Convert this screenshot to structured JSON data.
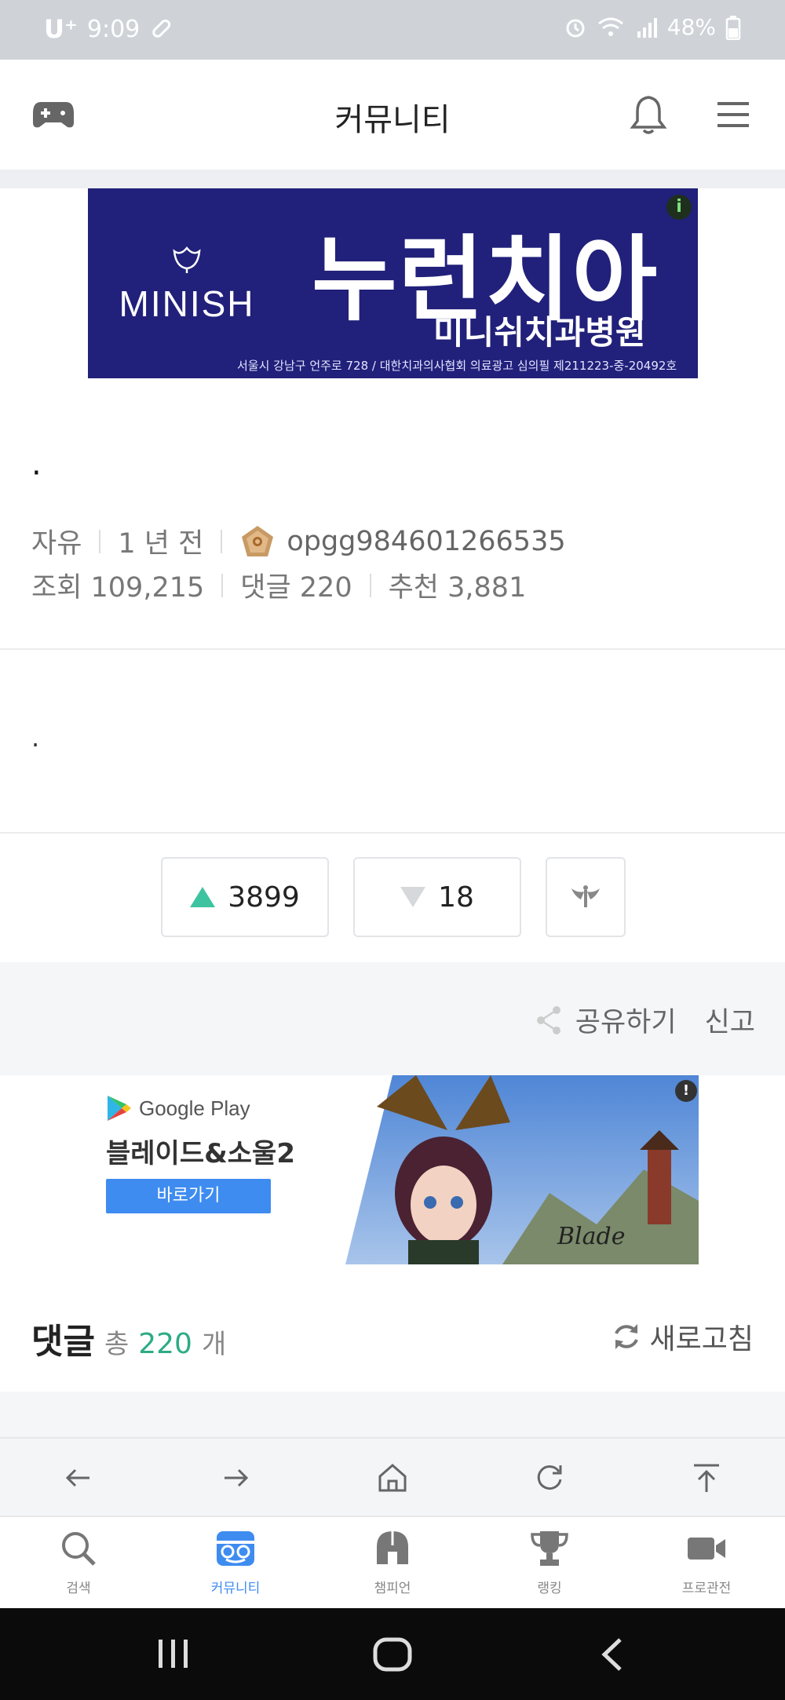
{
  "status_bar": {
    "carrier": "U⁺",
    "time": "9:09",
    "battery": "48%"
  },
  "header": {
    "title": "커뮤니티",
    "left_icon": "gamepad-icon",
    "right_icons": [
      "bell-icon",
      "menu-icon"
    ]
  },
  "ad_top": {
    "brand": "MINISH",
    "headline": "누런치아",
    "subline": "미니쉬치과병원",
    "fineprint": "서울시 강남구 언주로 728 / 대한치과의사협회 의료광고 심의필 제211223-중-20492호",
    "badge": "i"
  },
  "post": {
    "title": "·",
    "category": "자유",
    "time": "1 년 전",
    "author": "opgg984601266535",
    "views": "조회 109,215",
    "comments": "댓글 220",
    "recommends": "추천 3,881",
    "body": "·"
  },
  "votes": {
    "up": "3899",
    "down": "18"
  },
  "share": {
    "share_label": "공유하기",
    "report_label": "신고"
  },
  "ad_mid": {
    "store": "Google Play",
    "game": "블레이드&소울2",
    "cta": "바로가기",
    "badge": "!"
  },
  "comments_header": {
    "title": "댓글",
    "total_label": "총",
    "count": "220",
    "unit": "개",
    "refresh": "새로고침"
  },
  "tabs": [
    {
      "label": "검색",
      "icon": "search-icon"
    },
    {
      "label": "커뮤니티",
      "icon": "community-icon",
      "active": true
    },
    {
      "label": "챔피언",
      "icon": "helmet-icon"
    },
    {
      "label": "랭킹",
      "icon": "trophy-icon"
    },
    {
      "label": "프로관전",
      "icon": "video-camera-icon"
    }
  ],
  "colors": {
    "accent_green": "#3ec3a0",
    "accent_blue": "#3f8cf0",
    "ad_navy": "#21207a"
  }
}
